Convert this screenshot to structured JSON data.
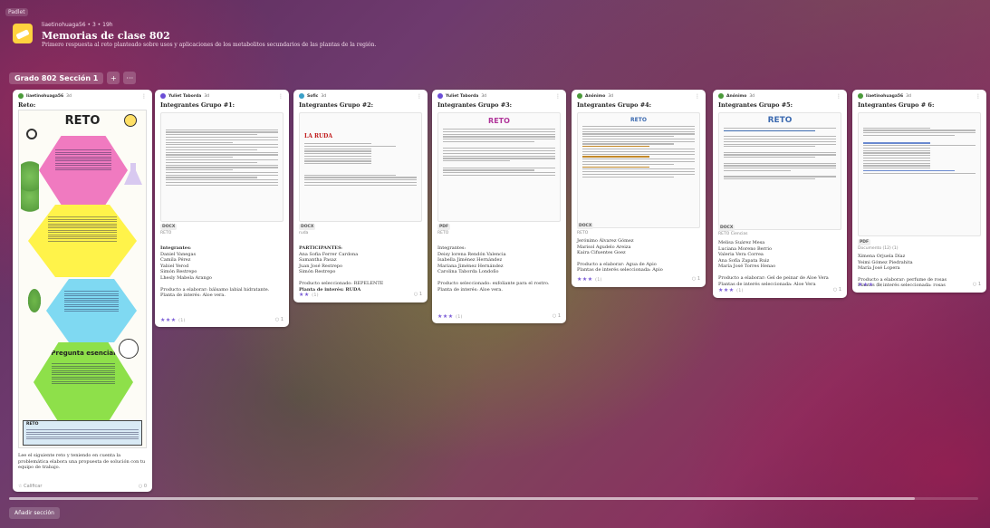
{
  "padlet_tag": "Padlet",
  "header": {
    "meta": "liaetinohuaga56 • 3 • 19h",
    "title": "Memorias de clase 802",
    "subtitle": "Primero respuesta al reto planteado sobre usos y aplicaciones de los metabolitos secundarios de las plantas de la región."
  },
  "section": {
    "title": "Grado 802 Sección 1",
    "add_label": "+",
    "more_label": "···"
  },
  "add_section_label": "Añadir sección",
  "cards": [
    {
      "author": "liaetinohuaga56",
      "time": "3d",
      "title": "Reto:",
      "poster": {
        "title": "RETO",
        "question_title": "Pregunta esencial",
        "bottom_title": "RETO"
      },
      "body": "Lee el siguiente reto y teniendo en cuenta la problemática elabora una propuesta de solución con tu equipo de trabajo.",
      "grade": "☆ Calificar",
      "comments": "0"
    },
    {
      "author": "Yuliet Taborda",
      "time": "3d",
      "title": "Integrantes Grupo #1:",
      "att_badge": "DOCX",
      "att_caption": "RETO",
      "body_head": "Integrantes",
      "members": [
        "Daniel Vanegas",
        "Camila Pérez",
        "Yabiel Yerod",
        "Simón Restrepo",
        "Lhesly Mabela Arango"
      ],
      "product": "Producto a elaborar: bálsamo labial hidratante.",
      "plant": "Planta de interés: Aloe vera.",
      "stars": "★★★",
      "star_count": "(1)",
      "comments": "1"
    },
    {
      "author": "Sofic",
      "time": "3d",
      "title": "Integrantes Grupo #2:",
      "att_title": "LA RUDA",
      "att_badge": "DOCX",
      "att_caption": "ruda",
      "body_head": "PARTICIPANTES",
      "members": [
        "Ana Sofia Ferrer Cardona",
        "Samantha Pasaz",
        "Juan José Restrepo",
        "Simón Restrepo"
      ],
      "product": "Producto seleccionado: REPELENTE",
      "plant": "Planta de interés: RUDA",
      "stars": "★★",
      "star_count": "(1)",
      "comments": "1"
    },
    {
      "author": "Yuliet Taborda",
      "time": "3d",
      "title": "Integrantes Grupo #3:",
      "att_title": "RETO",
      "att_badge": "PDF",
      "att_caption": "RETO",
      "body_head": "Integrantes:",
      "members": [
        "Deisy lorena Rendón Valencia",
        "Isabella Jiménez Hernández",
        "Mariana Jiménez Hernández",
        "Carolina Taborda Londoño"
      ],
      "product": "Producto seleccionado: exfoliante para el rostro.",
      "plant": "Planta de interés: Aloe vera.",
      "stars": "★★★",
      "star_count": "(1)",
      "comments": "1"
    },
    {
      "author": "Anónimo",
      "time": "3d",
      "title": "Integrantes Grupo #4:",
      "att_title": "RETO",
      "att_badge": "DOCX",
      "att_caption": "RETO",
      "members": [
        "Jerónimo Álvarez Gómez",
        "Marisol Agudelo Areiza",
        "Kaira Cifuentes Goez"
      ],
      "product": "Producto a elaborar: Agua de Apio",
      "plant": "Plantas de interés seleccionada: Apio",
      "stars": "★★★",
      "star_count": "(1)",
      "comments": "1"
    },
    {
      "author": "Anónimo",
      "time": "3d",
      "title": "Integrantes Grupo #5:",
      "att_title": "RETO",
      "att_badge": "DOCX",
      "att_caption": "RETO Ciencias",
      "members": [
        "Melisa Suárez Mesa",
        "Luciana Moreno Berrio",
        "Valeria Vera Correa",
        "Ana Sofía Zapata Ruiz",
        "María José Torres Henao"
      ],
      "product": "Producto a elaborar: Gel de peinar de Aloe Vera",
      "plant": "Plantas de interés seleccionada: Aloe Vera",
      "stars": "★★★",
      "star_count": "(1)",
      "comments": "1"
    },
    {
      "author": "liaetinohuaga56",
      "time": "3d",
      "title": "Integrantes Grupo # 6:",
      "att_badge": "PDF",
      "att_caption": "Documento (12) (1)",
      "members": [
        "Ximena Orjuela Díaz",
        "Yeimi Gómez Piedrahita",
        "María José Lopera"
      ],
      "product": "Producto a elaborar: perfume de rosas",
      "plant": "Plantas de interés seleccionada: rosas",
      "stars": "★★★",
      "star_count": "(1)",
      "comments": "1"
    }
  ],
  "colors": {
    "accent": "#7a5cd6",
    "doc_title": "#b0359a",
    "ruda_title": "#c01818"
  }
}
